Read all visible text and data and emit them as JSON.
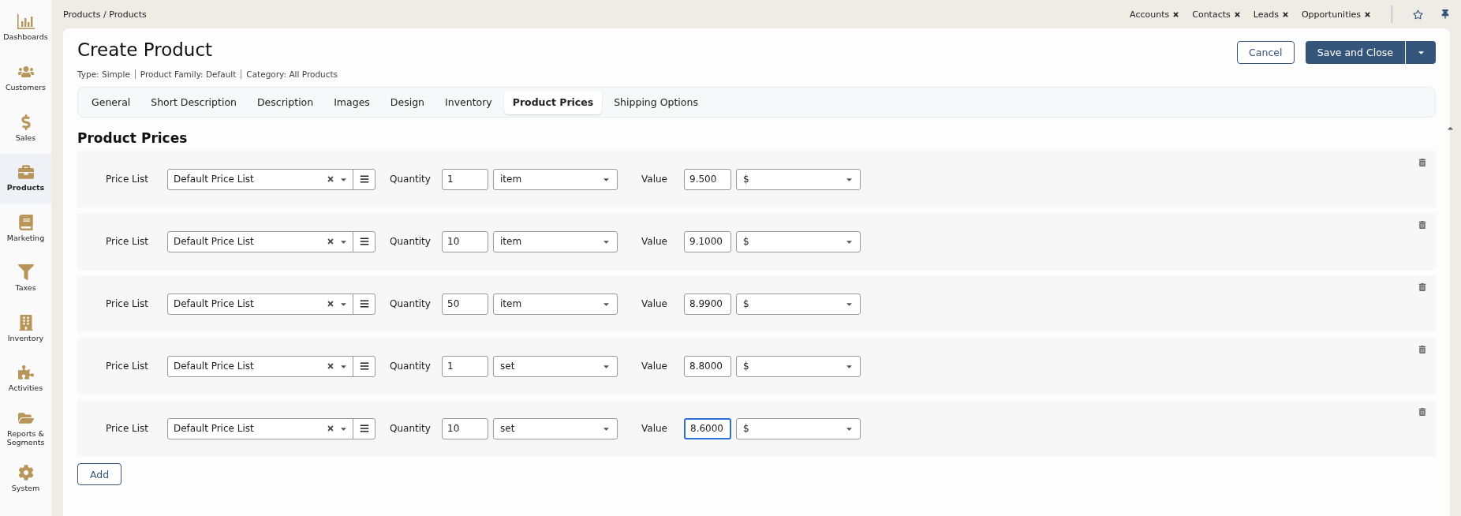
{
  "sidebar": {
    "items": [
      {
        "label": "Dashboards",
        "selected": false
      },
      {
        "label": "Customers",
        "selected": false
      },
      {
        "label": "Sales",
        "selected": false
      },
      {
        "label": "Products",
        "selected": true
      },
      {
        "label": "Marketing",
        "selected": false
      },
      {
        "label": "Taxes",
        "selected": false
      },
      {
        "label": "Inventory",
        "selected": false
      },
      {
        "label": "Activities",
        "selected": false
      },
      {
        "label": "Reports & Segments",
        "selected": false
      },
      {
        "label": "System",
        "selected": false
      }
    ]
  },
  "breadcrumb": "Products / Products",
  "quick_links": [
    "Accounts",
    "Contacts",
    "Leads",
    "Opportunities"
  ],
  "page": {
    "title": "Create Product",
    "meta": [
      "Type: Simple",
      "Product Family: Default",
      "Category: All Products"
    ],
    "buttons": {
      "cancel": "Cancel",
      "save": "Save and Close"
    }
  },
  "tabs": [
    {
      "label": "General",
      "selected": false
    },
    {
      "label": "Short Description",
      "selected": false
    },
    {
      "label": "Description",
      "selected": false
    },
    {
      "label": "Images",
      "selected": false
    },
    {
      "label": "Design",
      "selected": false
    },
    {
      "label": "Inventory",
      "selected": false
    },
    {
      "label": "Product Prices",
      "selected": true
    },
    {
      "label": "Shipping Options",
      "selected": false
    }
  ],
  "section_title": "Product Prices",
  "price_rows": [
    {
      "price_list_label": "Price List",
      "price_list": "Default Price List",
      "quantity_label": "Quantity",
      "quantity": "1",
      "unit": "item",
      "value_label": "Value",
      "value": "9.500",
      "currency": "$",
      "focused": false
    },
    {
      "price_list_label": "Price List",
      "price_list": "Default Price List",
      "quantity_label": "Quantity",
      "quantity": "10",
      "unit": "item",
      "value_label": "Value",
      "value": "9.1000",
      "currency": "$",
      "focused": false
    },
    {
      "price_list_label": "Price List",
      "price_list": "Default Price List",
      "quantity_label": "Quantity",
      "quantity": "50",
      "unit": "item",
      "value_label": "Value",
      "value": "8.9900",
      "currency": "$",
      "focused": false
    },
    {
      "price_list_label": "Price List",
      "price_list": "Default Price List",
      "quantity_label": "Quantity",
      "quantity": "1",
      "unit": "set",
      "value_label": "Value",
      "value": "8.8000",
      "currency": "$",
      "focused": false
    },
    {
      "price_list_label": "Price List",
      "price_list": "Default Price List",
      "quantity_label": "Quantity",
      "quantity": "10",
      "unit": "set",
      "value_label": "Value",
      "value": "8.6000",
      "currency": "$",
      "focused": true
    }
  ],
  "add_button": "Add"
}
